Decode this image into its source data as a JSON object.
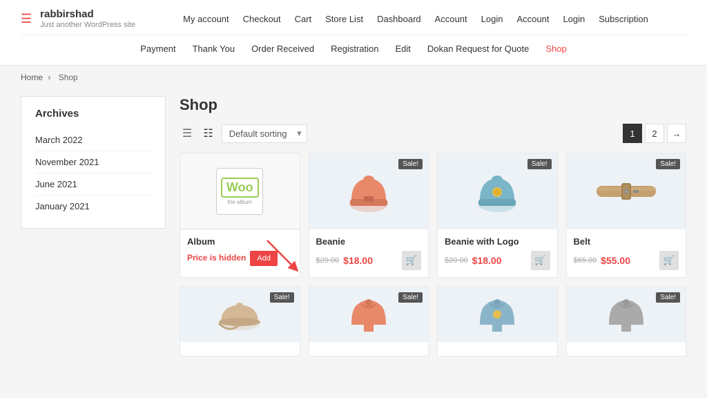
{
  "site": {
    "title": "rabbirshad",
    "tagline": "Just another WordPress site"
  },
  "nav_top": {
    "items": [
      {
        "label": "My account",
        "url": "#"
      },
      {
        "label": "Checkout",
        "url": "#"
      },
      {
        "label": "Cart",
        "url": "#"
      },
      {
        "label": "Store List",
        "url": "#"
      },
      {
        "label": "Dashboard",
        "url": "#"
      },
      {
        "label": "Account",
        "url": "#"
      },
      {
        "label": "Login",
        "url": "#"
      },
      {
        "label": "Account",
        "url": "#"
      },
      {
        "label": "Login",
        "url": "#"
      },
      {
        "label": "Subscription",
        "url": "#"
      }
    ]
  },
  "nav_bottom": {
    "items": [
      {
        "label": "Payment",
        "url": "#",
        "active": false
      },
      {
        "label": "Thank You",
        "url": "#",
        "active": false
      },
      {
        "label": "Order Received",
        "url": "#",
        "active": false
      },
      {
        "label": "Registration",
        "url": "#",
        "active": false
      },
      {
        "label": "Edit",
        "url": "#",
        "active": false
      },
      {
        "label": "Dokan Request for Quote",
        "url": "#",
        "active": false
      },
      {
        "label": "Shop",
        "url": "#",
        "active": true
      }
    ]
  },
  "breadcrumb": {
    "home": "Home",
    "current": "Shop"
  },
  "sidebar": {
    "widget_title": "Archives",
    "archives": [
      {
        "label": "March 2022"
      },
      {
        "label": "November 2021"
      },
      {
        "label": "June 2021"
      },
      {
        "label": "January 2021"
      }
    ]
  },
  "shop": {
    "title": "Shop",
    "sort_label": "Default sorting",
    "pagination": {
      "pages": [
        "1",
        "2"
      ],
      "next": "→"
    },
    "products_row1": [
      {
        "name": "Album",
        "type": "woo",
        "sale": false,
        "price_hidden": true,
        "price_hidden_text": "Price is hidden",
        "old_price": "",
        "new_price": "",
        "add_label": "Add"
      },
      {
        "name": "Beanie",
        "type": "beanie_pink",
        "sale": true,
        "price_hidden": false,
        "old_price": "$20.00",
        "new_price": "$18.00"
      },
      {
        "name": "Beanie with Logo",
        "type": "beanie_blue",
        "sale": true,
        "price_hidden": false,
        "old_price": "$20.00",
        "new_price": "$18.00"
      },
      {
        "name": "Belt",
        "type": "belt",
        "sale": true,
        "price_hidden": false,
        "old_price": "$65.00",
        "new_price": "$55.00"
      }
    ],
    "products_row2": [
      {
        "name": "",
        "type": "cap",
        "sale": true,
        "price_hidden": false,
        "old_price": "",
        "new_price": ""
      },
      {
        "name": "",
        "type": "hoodie_pink",
        "sale": true,
        "price_hidden": false,
        "old_price": "",
        "new_price": ""
      },
      {
        "name": "",
        "type": "hoodie_blue",
        "sale": false,
        "price_hidden": false,
        "old_price": "",
        "new_price": ""
      },
      {
        "name": "",
        "type": "hoodie_gray",
        "sale": true,
        "price_hidden": false,
        "old_price": "",
        "new_price": ""
      }
    ],
    "sale_badge": "Sale!",
    "cart_icon": "🛒"
  }
}
